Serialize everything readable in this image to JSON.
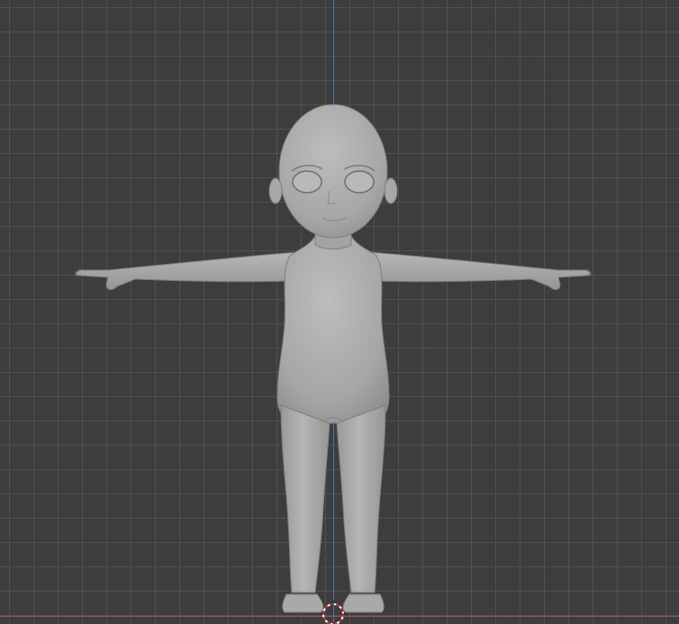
{
  "viewport": {
    "background_color": "#3d3d3d",
    "grid_color": "#5f5f5f",
    "axis_z_color": "#4a6fb5",
    "axis_x_color": "#b04a4a",
    "model_color": "#a8a8a8",
    "model_shade_color": "#8c8c8c",
    "model_icon": "character-base-mesh",
    "cursor_icon": "3d-cursor"
  }
}
